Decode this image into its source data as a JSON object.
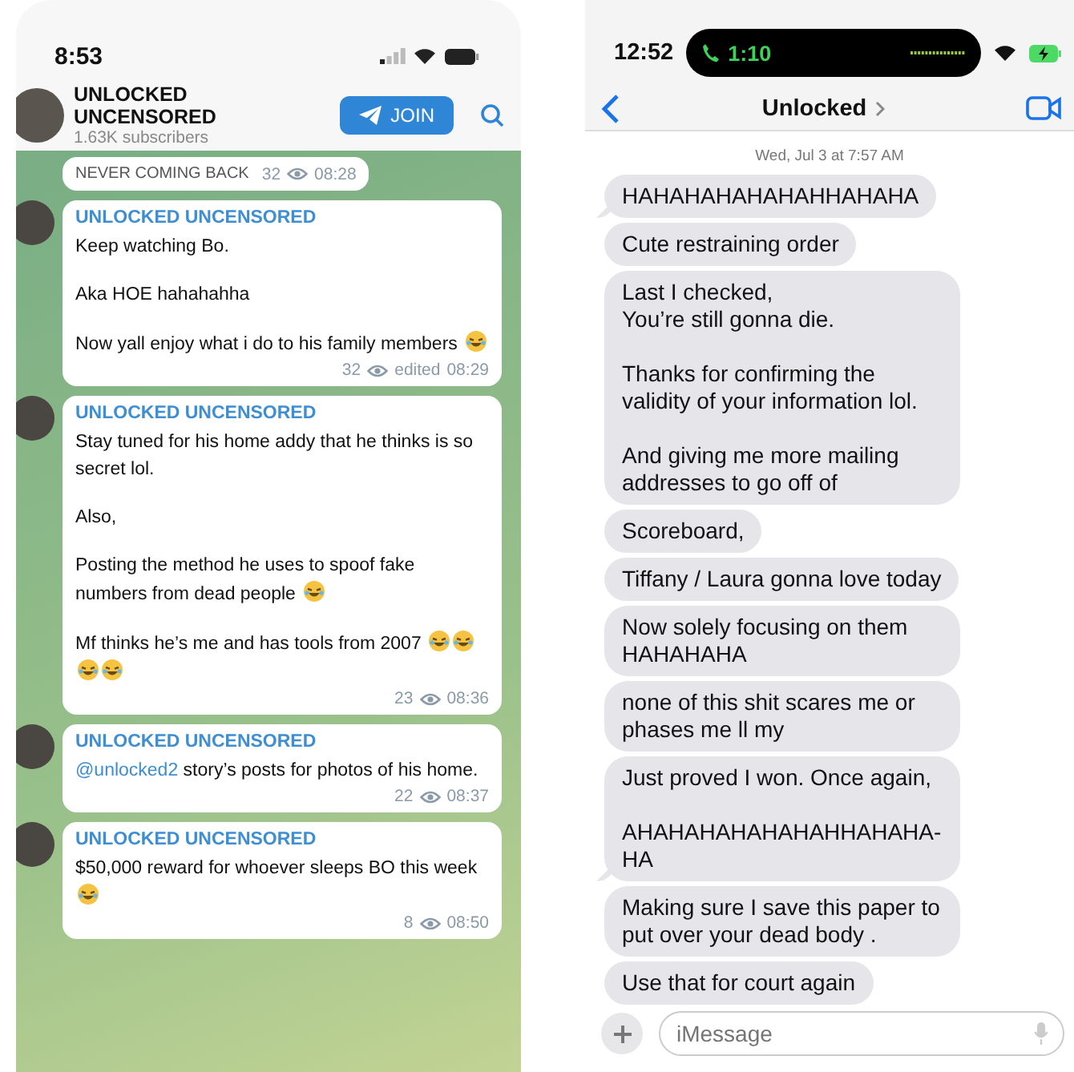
{
  "telegram": {
    "status_bar": {
      "time": "8:53"
    },
    "channel": {
      "name": "UNLOCKED UNCENSORED",
      "subscribers": "1.63K subscribers"
    },
    "join_button": "JOIN",
    "messages": [
      {
        "kind": "partial",
        "paragraphs": [
          {
            "text": "NEVER COMING BACK"
          }
        ],
        "views": "32",
        "time": "08:28"
      },
      {
        "kind": "post",
        "author": "UNLOCKED UNCENSORED",
        "paragraphs": [
          {
            "text": "Keep watching Bo."
          },
          {
            "text": "Aka HOE hahahahha"
          },
          {
            "text": "Now yall enjoy what i do to his family members",
            "emojis": [
              {
                "kind": "laugh"
              }
            ]
          }
        ],
        "views": "32",
        "edited": "edited",
        "time": "08:29"
      },
      {
        "kind": "post",
        "author": "UNLOCKED UNCENSORED",
        "paragraphs": [
          {
            "text": "Stay tuned for his home addy that he thinks is so secret lol."
          },
          {
            "text": "Also,"
          },
          {
            "text": "Posting the method he uses to spoof fake numbers from dead people",
            "emojis": [
              {
                "kind": "laugh"
              }
            ]
          },
          {
            "text": "Mf thinks he’s me and has tools from 2007",
            "emojis": [
              {
                "kind": "laugh"
              },
              {
                "kind": "laugh"
              },
              {
                "kind": "laugh"
              },
              {
                "kind": "laugh"
              }
            ]
          }
        ],
        "views": "23",
        "time": "08:36"
      },
      {
        "kind": "post",
        "author": "UNLOCKED UNCENSORED",
        "mention": "@unlocked2",
        "paragraphs": [
          {
            "text": "story’s posts for photos of his home."
          }
        ],
        "views": "22",
        "time": "08:37"
      },
      {
        "kind": "post",
        "author": "UNLOCKED UNCENSORED",
        "paragraphs": [
          {
            "text": "$50,000 reward for whoever sleeps BO this week",
            "emojis": [
              {
                "kind": "laugh"
              }
            ]
          }
        ],
        "views": "8",
        "time": "08:50"
      }
    ]
  },
  "imessage": {
    "status_bar": {
      "time": "12:52",
      "call_time": "1:10"
    },
    "contact": "Unlocked",
    "date": "Wed, Jul 3 at 7:57 AM",
    "bubbles": [
      {
        "text": "HAHAHAHAHAHAHHAHAHA",
        "tail": true
      },
      {
        "text": "Cute restraining order",
        "tail": false
      },
      {
        "text": "Last I checked,\nYou’re still gonna die.\n\nThanks for confirming the validity of your information lol.\n\nAnd giving me more mailing addresses to go off of",
        "tail": false
      },
      {
        "text": "Scoreboard,",
        "tail": false
      },
      {
        "text": "Tiffany / Laura gonna love today",
        "tail": false
      },
      {
        "text": "Now solely focusing on them HAHAHAHA",
        "tail": false
      },
      {
        "text": "none of this shit scares me or phases me ll my",
        "tail": false
      },
      {
        "text": "Just proved I won. Once again,\n\nAHAHAHAHAHAHAHHAHAHA-HA",
        "tail": true
      },
      {
        "text": "Making sure I save this paper to put over your dead body .",
        "tail": false
      },
      {
        "text": "Use that for court again",
        "tail": false
      }
    ],
    "input": {
      "placeholder": "iMessage"
    }
  }
}
